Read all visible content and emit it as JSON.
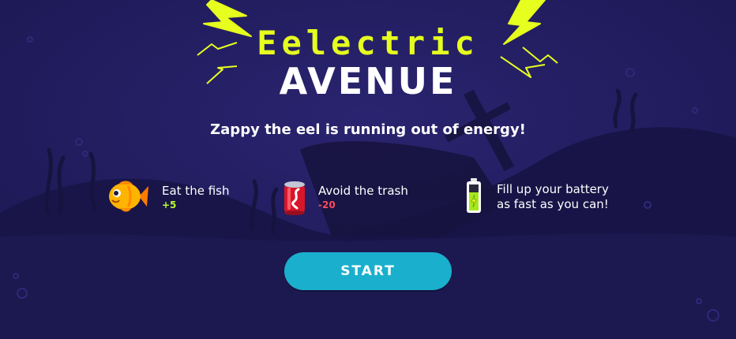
{
  "title": {
    "line1": "Eelectric",
    "line2": "AVENUE"
  },
  "subtitle": "Zappy the eel is running out of energy!",
  "instructions": [
    {
      "icon": "fish-icon",
      "text": "Eat the fish",
      "points": "+5"
    },
    {
      "icon": "soda-can-icon",
      "text": "Avoid the trash",
      "points": "-20"
    },
    {
      "icon": "battery-icon",
      "line1": "Fill up your battery",
      "line2": "as fast as you can!"
    }
  ],
  "start_button": {
    "label": "START"
  },
  "colors": {
    "background": "#201c5c",
    "accent_yellow": "#e6ff1e",
    "button": "#1ab0cd",
    "positive": "#b7ff2a",
    "negative": "#ff4a5c"
  }
}
